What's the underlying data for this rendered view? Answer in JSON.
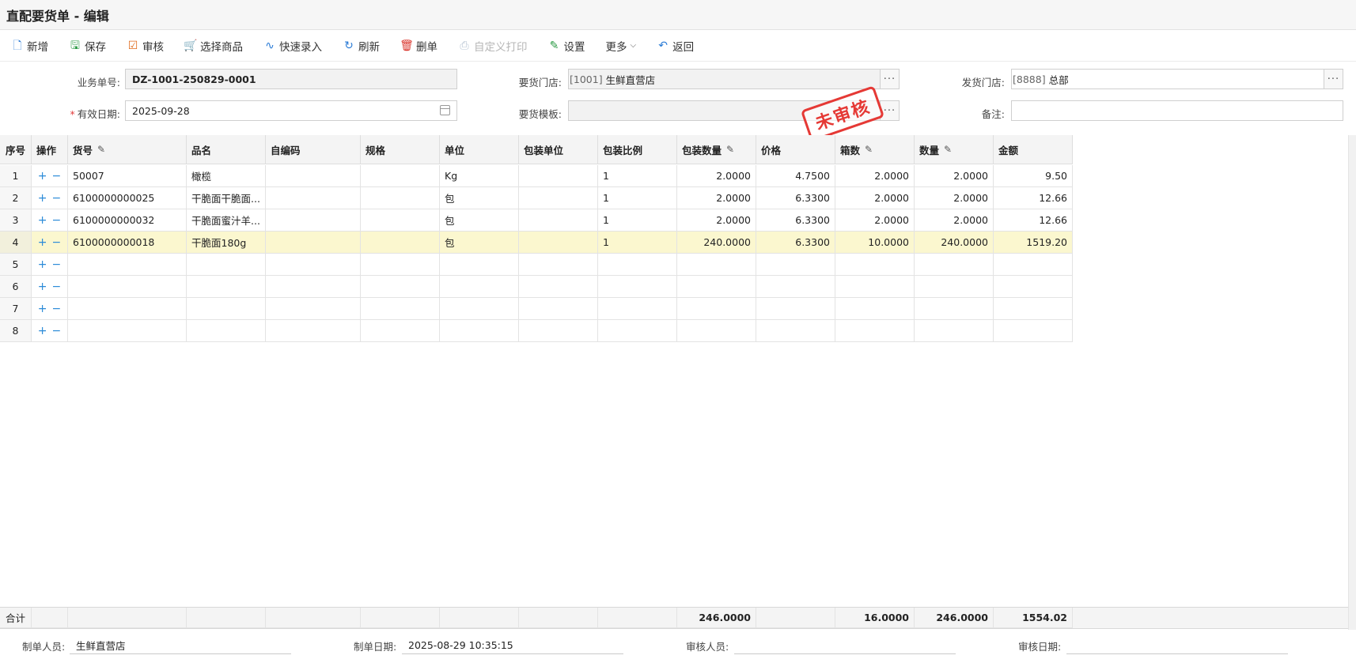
{
  "window": {
    "title": "直配要货单 - 编辑"
  },
  "toolbar": [
    {
      "label": "新增",
      "icon": "new-doc-icon",
      "disabled": false
    },
    {
      "label": "保存",
      "icon": "save-icon",
      "disabled": false
    },
    {
      "label": "审核",
      "icon": "check-icon",
      "disabled": false
    },
    {
      "label": "选择商品",
      "icon": "cart-icon",
      "disabled": false
    },
    {
      "label": "快速录入",
      "icon": "pulse-icon",
      "disabled": false
    },
    {
      "label": "刷新",
      "icon": "refresh-icon",
      "disabled": false
    },
    {
      "label": "删单",
      "icon": "delete-doc-icon",
      "disabled": false
    },
    {
      "label": "自定义打印",
      "icon": "print-icon",
      "disabled": true
    },
    {
      "label": "设置",
      "icon": "edit-icon",
      "disabled": false
    },
    {
      "label": "更多",
      "icon": "",
      "disabled": false
    },
    {
      "label": "返回",
      "icon": "back-icon",
      "disabled": false
    }
  ],
  "form": {
    "order_no_label": "业务单号:",
    "order_no": "DZ-1001-250829-0001",
    "valid_date_label": "有效日期:",
    "valid_date_req": "*",
    "valid_date": "2025-09-28",
    "req_store_label": "要货门店:",
    "req_store_code": "[1001]",
    "req_store_name": "生鲜直营店",
    "template_label": "要货模板:",
    "template_value": "",
    "ship_store_label": "发货门店:",
    "ship_store_code": "[8888]",
    "ship_store_name": "总部",
    "remark_label": "备注:",
    "remark_value": ""
  },
  "stamp": "未审核",
  "table": {
    "headers": [
      "序号",
      "操作",
      "货号",
      "品名",
      "自编码",
      "规格",
      "单位",
      "包装单位",
      "包装比例",
      "包装数量",
      "价格",
      "箱数",
      "数量",
      "金额"
    ],
    "editable_cols": [
      2,
      9,
      11,
      12
    ],
    "rows": [
      [
        "1",
        "",
        "50007",
        "橄榄",
        "",
        "",
        "Kg",
        "",
        "1",
        "2.0000",
        "4.7500",
        "2.0000",
        "2.0000",
        "9.50"
      ],
      [
        "2",
        "",
        "6100000000025",
        "干脆面干脆面...",
        "",
        "",
        "包",
        "",
        "1",
        "2.0000",
        "6.3300",
        "2.0000",
        "2.0000",
        "12.66"
      ],
      [
        "3",
        "",
        "6100000000032",
        "干脆面蜜汁羊...",
        "",
        "",
        "包",
        "",
        "1",
        "2.0000",
        "6.3300",
        "2.0000",
        "2.0000",
        "12.66"
      ],
      [
        "4",
        "",
        "6100000000018",
        "干脆面180g",
        "",
        "",
        "包",
        "",
        "1",
        "240.0000",
        "6.3300",
        "10.0000",
        "240.0000",
        "1519.20"
      ],
      [
        "5",
        "",
        "",
        "",
        "",
        "",
        "",
        "",
        "",
        "",
        "",
        "",
        "",
        ""
      ],
      [
        "6",
        "",
        "",
        "",
        "",
        "",
        "",
        "",
        "",
        "",
        "",
        "",
        "",
        ""
      ],
      [
        "7",
        "",
        "",
        "",
        "",
        "",
        "",
        "",
        "",
        "",
        "",
        "",
        "",
        ""
      ],
      [
        "8",
        "",
        "",
        "",
        "",
        "",
        "",
        "",
        "",
        "",
        "",
        "",
        "",
        ""
      ]
    ],
    "highlight_row": 3,
    "ops_plus": "+",
    "ops_minus": "−",
    "totals": [
      "合计",
      "",
      "",
      "",
      "",
      "",
      "",
      "",
      "",
      "246.0000",
      "",
      "16.0000",
      "246.0000",
      "1554.02"
    ]
  },
  "footer": {
    "creator_label": "制单人员:",
    "creator": "生鲜直营店",
    "created_label": "制单日期:",
    "created": "2025-08-29 10:35:15",
    "auditor_label": "审核人员:",
    "auditor": "",
    "audit_date_label": "审核日期:",
    "audit_date": ""
  }
}
